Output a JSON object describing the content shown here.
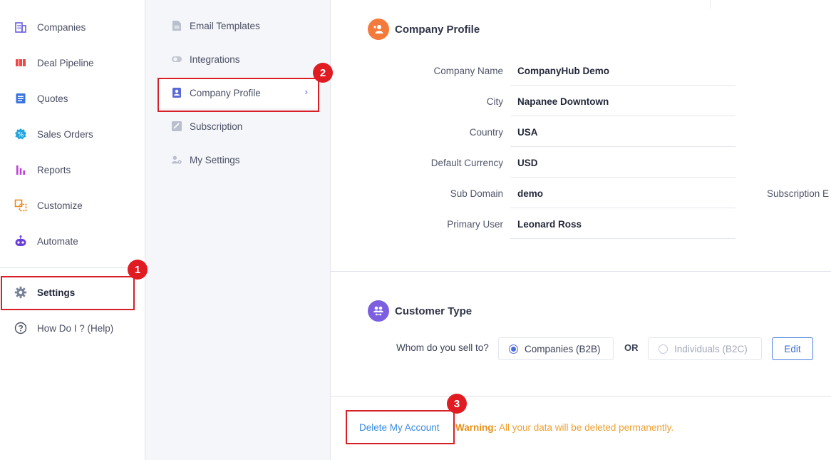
{
  "nav": {
    "items": [
      {
        "label": "Companies",
        "icon": "companies-icon"
      },
      {
        "label": "Deal Pipeline",
        "icon": "pipeline-icon"
      },
      {
        "label": "Quotes",
        "icon": "quotes-icon"
      },
      {
        "label": "Sales Orders",
        "icon": "sales-orders-icon"
      },
      {
        "label": "Reports",
        "icon": "reports-icon"
      },
      {
        "label": "Customize",
        "icon": "customize-icon"
      },
      {
        "label": "Automate",
        "icon": "robot-icon"
      }
    ],
    "settings": "Settings",
    "help": "How Do I ? (Help)"
  },
  "submenu": {
    "email_templates": "Email Templates",
    "integrations": "Integrations",
    "company_profile": "Company Profile",
    "subscription": "Subscription",
    "my_settings": "My Settings"
  },
  "profile": {
    "title": "Company Profile",
    "rows": [
      {
        "label": "Company Name",
        "value": "CompanyHub Demo"
      },
      {
        "label": "City",
        "value": "Napanee Downtown"
      },
      {
        "label": "Country",
        "value": "USA"
      },
      {
        "label": "Default Currency",
        "value": "USD"
      },
      {
        "label": "Sub Domain",
        "value": "demo"
      },
      {
        "label": "Primary User",
        "value": "Leonard Ross"
      }
    ],
    "cut_label": "Subscription E"
  },
  "customer_type": {
    "title": "Customer Type",
    "question": "Whom do you sell to?",
    "option_b2b": "Companies (B2B)",
    "or": "OR",
    "option_b2c": "Individuals (B2C)",
    "edit": "Edit",
    "selected": "Companies (B2B)"
  },
  "danger": {
    "delete": "Delete My Account",
    "warning_label": "Warning:",
    "warning_text": "All your data will be deleted permanently."
  },
  "annotations": [
    "1",
    "2",
    "3"
  ],
  "colors": {
    "highlight": "#d81f26",
    "accent": "#5a6bd8",
    "warning": "#f0a030",
    "link": "#3a8be0"
  }
}
